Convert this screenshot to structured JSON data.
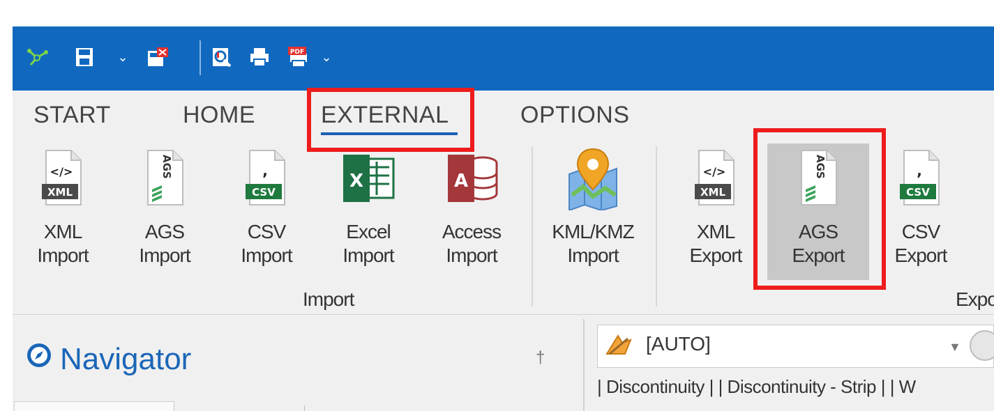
{
  "quick_access": {
    "icons": [
      "graph-icon",
      "save-icon",
      "dropdown-icon",
      "close-file-icon",
      "print-preview-icon",
      "print-icon",
      "pdf-icon",
      "dropdown-icon"
    ]
  },
  "tabs": [
    {
      "label": "START"
    },
    {
      "label": "HOME"
    },
    {
      "label": "EXTERNAL",
      "active": true
    },
    {
      "label": "OPTIONS"
    }
  ],
  "ribbon": {
    "import_buttons": [
      {
        "line1": "XML",
        "line2": "Import",
        "icon": "xml-file-icon"
      },
      {
        "line1": "AGS",
        "line2": "Import",
        "icon": "ags-file-icon"
      },
      {
        "line1": "CSV",
        "line2": "Import",
        "icon": "csv-file-icon"
      },
      {
        "line1": "Excel",
        "line2": "Import",
        "icon": "excel-icon"
      },
      {
        "line1": "Access",
        "line2": "Import",
        "icon": "access-icon"
      },
      {
        "line1": "KML/KMZ",
        "line2": "Import",
        "icon": "map-pin-icon"
      }
    ],
    "import_group_label": "Import",
    "export_buttons": [
      {
        "line1": "XML",
        "line2": "Export",
        "icon": "xml-file-icon"
      },
      {
        "line1": "AGS",
        "line2": "Export",
        "icon": "ags-file-icon",
        "selected": true
      },
      {
        "line1": "CSV",
        "line2": "Export",
        "icon": "csv-file-icon"
      }
    ],
    "export_group_label": "Expo"
  },
  "navigator": {
    "title": "Navigator",
    "pin": "†"
  },
  "right_panel": {
    "combo_value": "[AUTO]",
    "tab_strip": "| Discontinuity |   | Discontinuity - Strip |   | W"
  },
  "colors": {
    "title_bar": "#1069bf",
    "ribbon_bg": "#f0f0f0",
    "highlight": "#ee1c1c",
    "accent": "#1a5fb4"
  },
  "file_badges": {
    "xml": "XML",
    "csv": "CSV",
    "ags": "AGS",
    "xml_glyph": "</>",
    "csv_glyph": ",",
    "excel_letter": "X",
    "access_letter": "A",
    "pdf": "PDF"
  }
}
